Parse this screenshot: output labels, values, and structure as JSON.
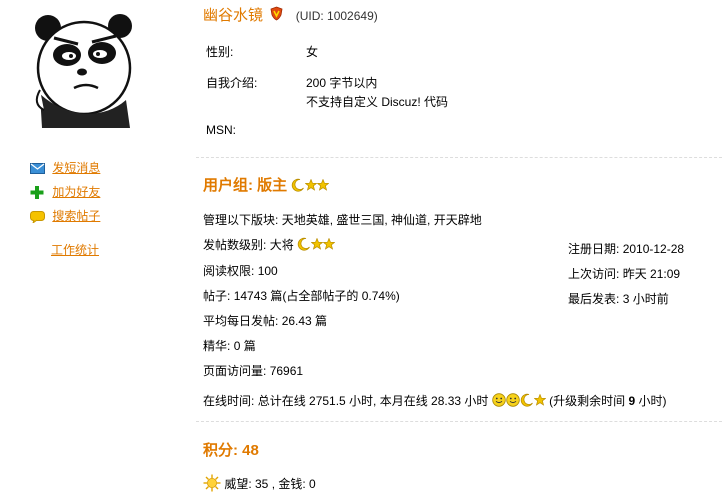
{
  "profile": {
    "username": "幽谷水镜",
    "uid": "(UID: 1002649)",
    "gender_label": "性别:",
    "gender_value": "女",
    "intro_label": "自我介绍:",
    "intro_line1": "200 字节以内",
    "intro_line2": "不支持自定义 Discuz! 代码",
    "msn_label": "MSN:"
  },
  "sidebar": {
    "items": [
      {
        "label": "发短消息",
        "icon": "envelope-icon"
      },
      {
        "label": "加为好友",
        "icon": "plus-icon"
      },
      {
        "label": "搜索帖子",
        "icon": "speech-bubble-icon"
      },
      {
        "label": "工作统计",
        "icon": ""
      }
    ]
  },
  "group": {
    "title": "用户组: 版主",
    "manage_label": "管理以下版块:",
    "boards": "天地英雄, 盛世三国, 神仙道, 开天辟地",
    "post_level_label": "发帖数级别:",
    "post_level_value": "大将",
    "read_label": "阅读权限:",
    "read_value": "100",
    "posts_label": "帖子:",
    "posts_value": "14743 篇(占全部帖子的 0.74%)",
    "daily_label": "平均每日发帖:",
    "daily_value": "26.43 篇",
    "digest_label": "精华:",
    "digest_value": "0 篇",
    "views_label": "页面访问量:",
    "views_value": "76961",
    "online_label": "在线时间:",
    "online_value": "总计在线 2751.5 小时, 本月在线 28.33 小时",
    "upgrade_prefix": "(升级剩余时间",
    "upgrade_hours": "9",
    "upgrade_suffix": "小时)"
  },
  "dates": {
    "reg_label": "注册日期:",
    "reg_value": "2010-12-28",
    "last_visit_label": "上次访问:",
    "last_visit_value": "昨天 21:09",
    "last_post_label": "最后发表:",
    "last_post_value": "3 小时前"
  },
  "credits": {
    "title": "积分: 48",
    "detail": "威望: 35 , 金钱: 0"
  },
  "colors": {
    "accent": "#e07a00",
    "star": "#f2c300",
    "divider": "#dddddd"
  }
}
